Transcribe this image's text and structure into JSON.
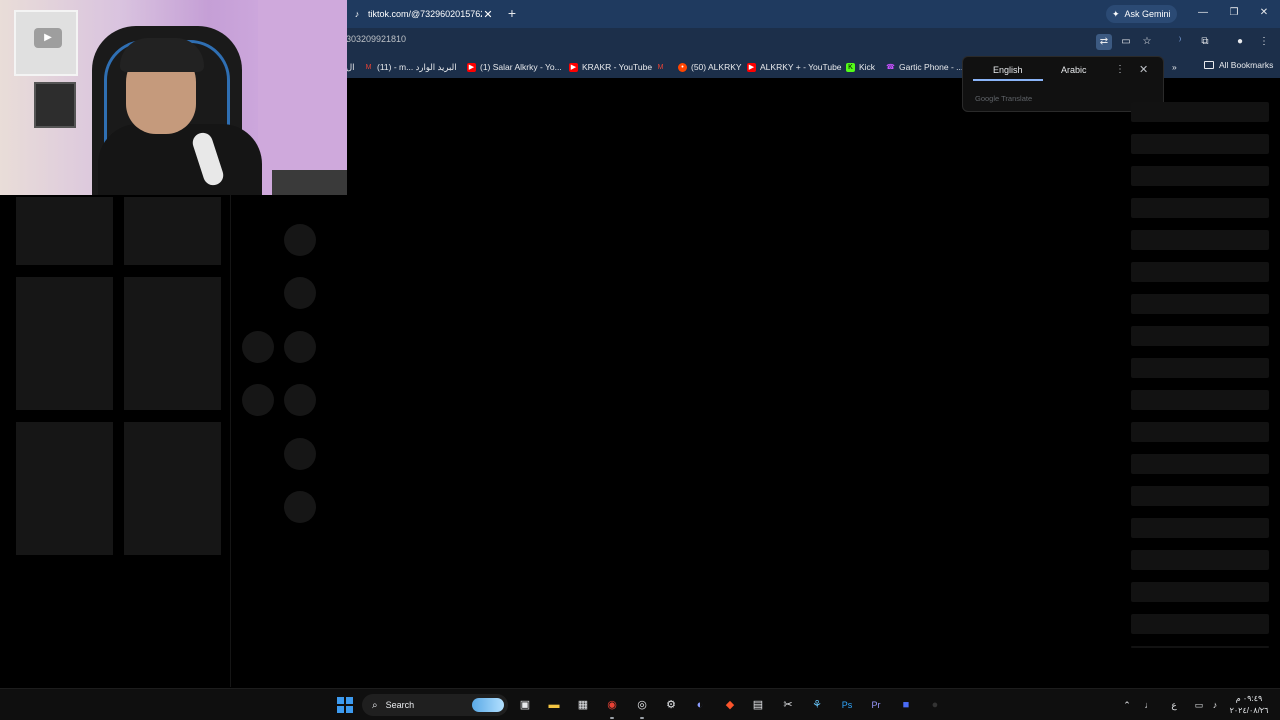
{
  "browser": {
    "tab": {
      "title": "tiktok.com/@7329602015762",
      "favicon": "tiktok-icon"
    },
    "new_tab_symbol": "+",
    "ask_gemini": "Ask Gemini",
    "window_controls": {
      "minimize": "—",
      "restore": "❐",
      "close": "✕"
    },
    "url": "303209921810",
    "bookmarks": [
      {
        "label": "ال",
        "icon": "bookmark-icon",
        "color": "#9e9e9e"
      },
      {
        "label": "(11) - m... البريد الوارد",
        "icon": "gmail-icon",
        "color": "#ea4335"
      },
      {
        "label": "(1) Salar Alkrky - Yo...",
        "icon": "youtube-icon",
        "color": "#ff0000"
      },
      {
        "label": "KRAKR - YouTube",
        "icon": "youtube-icon",
        "color": "#ff0000"
      },
      {
        "label": "",
        "icon": "gmail-icon",
        "color": "#ea4335"
      },
      {
        "label": "(50) ALKRKY",
        "icon": "reddit-icon",
        "color": "#ff4500"
      },
      {
        "label": "ALKRKY + - YouTube",
        "icon": "youtube-icon",
        "color": "#ff0000"
      },
      {
        "label": "Kick",
        "icon": "kick-icon",
        "color": "#53fc18"
      },
      {
        "label": "Gartic Phone - ...",
        "icon": "gartic-phone-icon",
        "color": "#c850ff"
      }
    ],
    "all_bookmarks": "All Bookmarks"
  },
  "translate_popup": {
    "tabs": [
      "English",
      "Arabic"
    ],
    "active_tab": "English",
    "brand": "Google Translate"
  },
  "taskbar": {
    "search_label": "Search",
    "pinned_apps": [
      "task-view-icon",
      "file-explorer-icon",
      "store-icon",
      "chrome-icon",
      "obs-icon",
      "steam-helper-icon",
      "discord-icon",
      "brave-icon",
      "calculator-icon",
      "capcut-icon",
      "steam-icon",
      "photoshop-icon",
      "premiere-icon",
      "roblox-icon"
    ],
    "tray_language": "ع",
    "clock_time": "٠٩:٤٩ م",
    "clock_date": "٢٠٢٤/٠٨/٢٦"
  }
}
